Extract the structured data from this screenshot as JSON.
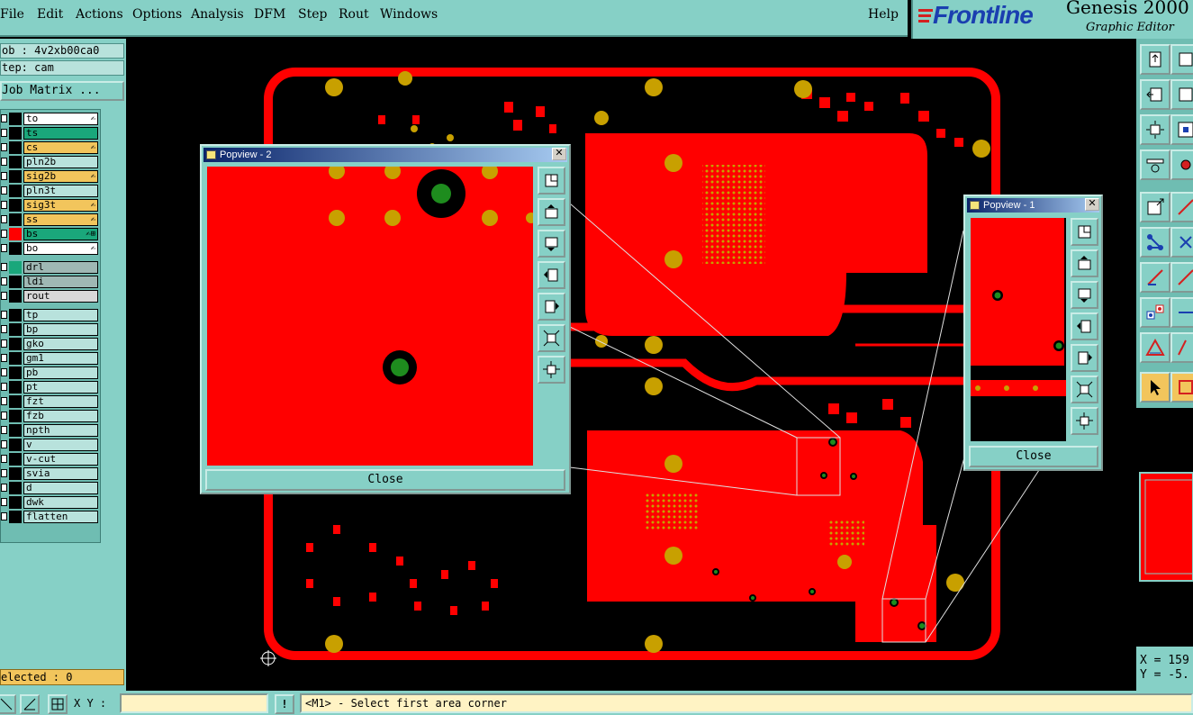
{
  "menubar": {
    "items": [
      "File",
      "Edit",
      "Actions",
      "Options",
      "Analysis",
      "DFM",
      "Step",
      "Rout",
      "Windows"
    ],
    "help": "Help"
  },
  "brand": {
    "logo": "Frontline",
    "title": "Genesis 2000",
    "subtitle": "Graphic Editor"
  },
  "job": {
    "job_label": "ob : 4v2xb00ca0",
    "step_label": "tep: cam",
    "matrix_button": "Job Matrix ..."
  },
  "layers": [
    {
      "name": "to",
      "color": "#ffffff",
      "flag": "✍"
    },
    {
      "name": "ts",
      "color": "#1aa77b",
      "flag": ""
    },
    {
      "name": "cs",
      "color": "#f2c55c",
      "flag": "✍"
    },
    {
      "name": "pln2b",
      "color": "#b8e2dc",
      "flag": ""
    },
    {
      "name": "sig2b",
      "color": "#f2c55c",
      "flag": "✍"
    },
    {
      "name": "pln3t",
      "color": "#b8e2dc",
      "flag": ""
    },
    {
      "name": "sig3t",
      "color": "#f2c55c",
      "flag": "✍"
    },
    {
      "name": "ss",
      "color": "#f2c55c",
      "flag": "✍"
    },
    {
      "name": "bs",
      "color": "#1aa77b",
      "flag": "✍⊞"
    },
    {
      "name": "bo",
      "color": "#ffffff",
      "flag": "✍"
    },
    {
      "name": "drl",
      "color": "#9fb8b4",
      "flag": ""
    },
    {
      "name": "ldi",
      "color": "#9fb8b4",
      "flag": ""
    },
    {
      "name": "rout",
      "color": "#d8d8d8",
      "flag": ""
    },
    {
      "name": "tp",
      "color": "#b8e2dc",
      "flag": ""
    },
    {
      "name": "bp",
      "color": "#b8e2dc",
      "flag": ""
    },
    {
      "name": "gko",
      "color": "#b8e2dc",
      "flag": ""
    },
    {
      "name": "gm1",
      "color": "#b8e2dc",
      "flag": ""
    },
    {
      "name": "pb",
      "color": "#b8e2dc",
      "flag": ""
    },
    {
      "name": "pt",
      "color": "#b8e2dc",
      "flag": ""
    },
    {
      "name": "fzt",
      "color": "#b8e2dc",
      "flag": ""
    },
    {
      "name": "fzb",
      "color": "#b8e2dc",
      "flag": ""
    },
    {
      "name": "npth",
      "color": "#b8e2dc",
      "flag": ""
    },
    {
      "name": "v",
      "color": "#b8e2dc",
      "flag": ""
    },
    {
      "name": "v-cut",
      "color": "#b8e2dc",
      "flag": ""
    },
    {
      "name": "svia",
      "color": "#b8e2dc",
      "flag": ""
    },
    {
      "name": "d",
      "color": "#b8e2dc",
      "flag": ""
    },
    {
      "name": "dwk",
      "color": "#b8e2dc",
      "flag": ""
    },
    {
      "name": "flatten",
      "color": "#b8e2dc",
      "flag": ""
    }
  ],
  "selected_label": "elected : 0",
  "status": {
    "xy_label": "X Y :",
    "xy_value": "",
    "message": "<M1> - Select first area corner"
  },
  "coords": {
    "x": "X = 159",
    "y": "Y = -5."
  },
  "popview2": {
    "title": "Popview - 2",
    "close": "Close"
  },
  "popview1": {
    "title": "Popview - 1",
    "close": "Close"
  },
  "colors": {
    "board": "#ff0000",
    "pad": "#c8a000",
    "drill": "#1e8c1e",
    "panel": "#86d0c6"
  }
}
